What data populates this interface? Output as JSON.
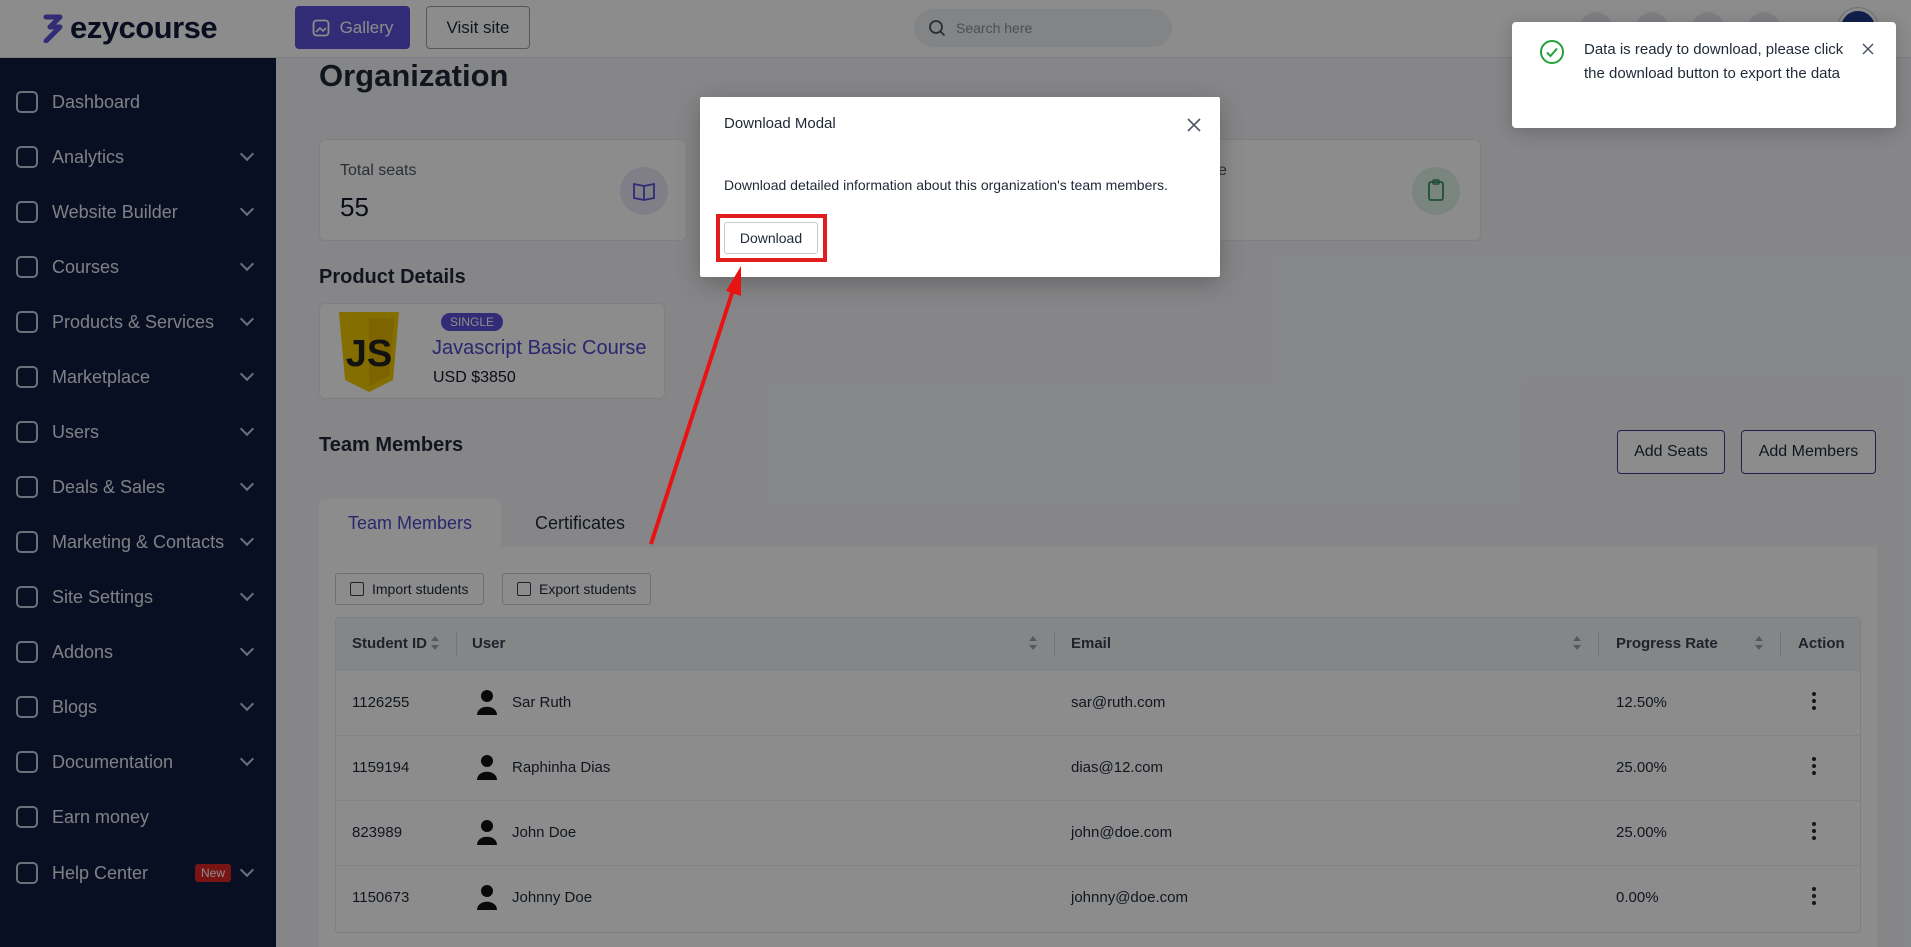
{
  "header": {
    "brand": "ezycourse",
    "gallery_label": "Gallery",
    "visit_site_label": "Visit site",
    "search_placeholder": "Search here"
  },
  "sidebar": {
    "items": [
      {
        "label": "Dashboard",
        "icon": "dashboard-icon",
        "chevron": false
      },
      {
        "label": "Analytics",
        "icon": "analytics-icon",
        "chevron": true
      },
      {
        "label": "Website Builder",
        "icon": "website-builder-icon",
        "chevron": true
      },
      {
        "label": "Courses",
        "icon": "courses-icon",
        "chevron": true
      },
      {
        "label": "Products & Services",
        "icon": "products-icon",
        "chevron": true
      },
      {
        "label": "Marketplace",
        "icon": "marketplace-icon",
        "chevron": true
      },
      {
        "label": "Users",
        "icon": "users-icon",
        "chevron": true
      },
      {
        "label": "Deals & Sales",
        "icon": "deals-icon",
        "chevron": true
      },
      {
        "label": "Marketing & Contacts",
        "icon": "marketing-icon",
        "chevron": true
      },
      {
        "label": "Site Settings",
        "icon": "settings-icon",
        "chevron": true
      },
      {
        "label": "Addons",
        "icon": "addons-icon",
        "chevron": true
      },
      {
        "label": "Blogs",
        "icon": "blogs-icon",
        "chevron": true
      },
      {
        "label": "Documentation",
        "icon": "documentation-icon",
        "chevron": true
      },
      {
        "label": "Earn money",
        "icon": "money-bag-icon",
        "chevron": false
      },
      {
        "label": "Help Center",
        "icon": "help-icon",
        "chevron": true,
        "badge": "New"
      }
    ]
  },
  "main": {
    "title": "Organization",
    "stats": {
      "total_seats_label": "Total seats",
      "total_seats_value": "55",
      "partial_label_suffix": "e"
    },
    "product_section_title": "Product Details",
    "product": {
      "badge": "SINGLE",
      "name": "Javascript Basic Course",
      "price": "USD $3850",
      "logo_text": "JS"
    },
    "team_section_title": "Team Members",
    "add_seats_label": "Add Seats",
    "add_members_label": "Add Members",
    "tabs": [
      "Team Members",
      "Certificates"
    ],
    "import_label": "Import students",
    "export_label": "Export students",
    "table": {
      "headers": [
        "Student ID",
        "User",
        "Email",
        "Progress Rate",
        "Action"
      ],
      "rows": [
        {
          "id": "1126255",
          "user": "Sar Ruth",
          "email": "sar@ruth.com",
          "progress": "12.50%"
        },
        {
          "id": "1159194",
          "user": "Raphinha Dias",
          "email": "dias@12.com",
          "progress": "25.00%"
        },
        {
          "id": "823989",
          "user": "John Doe",
          "email": "john@doe.com",
          "progress": "25.00%"
        },
        {
          "id": "1150673",
          "user": "Johnny Doe",
          "email": "johnny@doe.com",
          "progress": "0.00%"
        }
      ]
    }
  },
  "modal": {
    "title": "Download Modal",
    "body": "Download detailed information about this organization's team members.",
    "button_label": "Download"
  },
  "toast": {
    "message": "Data is ready to download, please click the download button to export the data"
  },
  "colors": {
    "sidebar_bg": "#101d3f",
    "accent": "#5b4fd6",
    "highlight": "#e11d1d",
    "success": "#22a33a"
  }
}
